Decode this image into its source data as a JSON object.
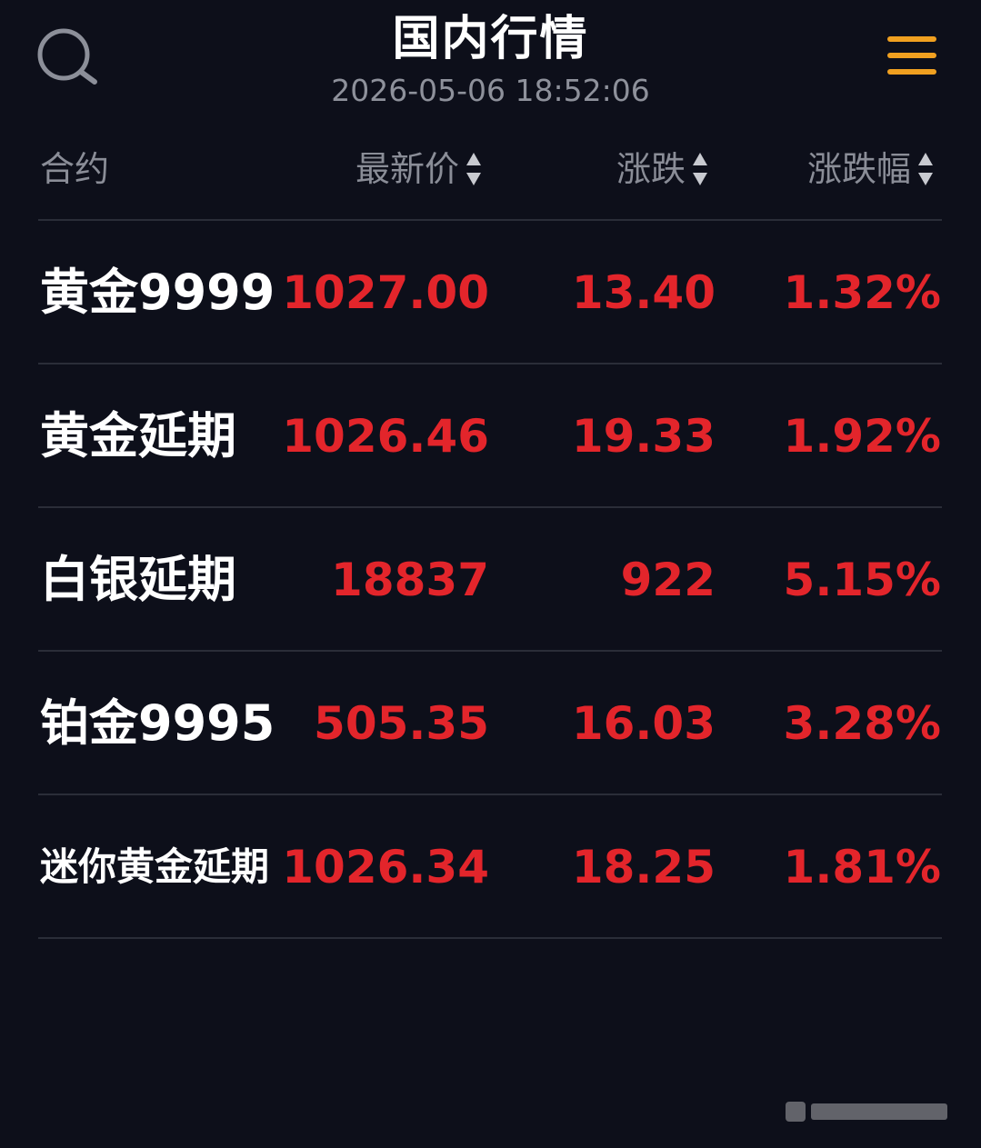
{
  "header": {
    "title": "国内行情",
    "timestamp": "2026-05-06 18:52:06",
    "search_icon": "search-icon",
    "menu_icon": "hamburger-menu-icon"
  },
  "columns": {
    "contract": "合约",
    "price": "最新价",
    "change": "涨跌",
    "change_pct": "涨跌幅"
  },
  "rows": [
    {
      "name": "黄金9999",
      "price": "1027.00",
      "change": "13.40",
      "change_pct": "1.32%"
    },
    {
      "name": "黄金延期",
      "price": "1026.46",
      "change": "19.33",
      "change_pct": "1.92%"
    },
    {
      "name": "白银延期",
      "price": "18837",
      "change": "922",
      "change_pct": "5.15%"
    },
    {
      "name": "铂金9995",
      "price": "505.35",
      "change": "16.03",
      "change_pct": "3.28%"
    },
    {
      "name": "迷你黄金延期",
      "price": "1026.34",
      "change": "18.25",
      "change_pct": "1.81%"
    }
  ],
  "colors": {
    "background": "#0d0f1a",
    "up_red": "#e3252b",
    "menu_accent": "#f0a020",
    "muted_text": "#8a8d97",
    "divider": "#2a2d38"
  }
}
